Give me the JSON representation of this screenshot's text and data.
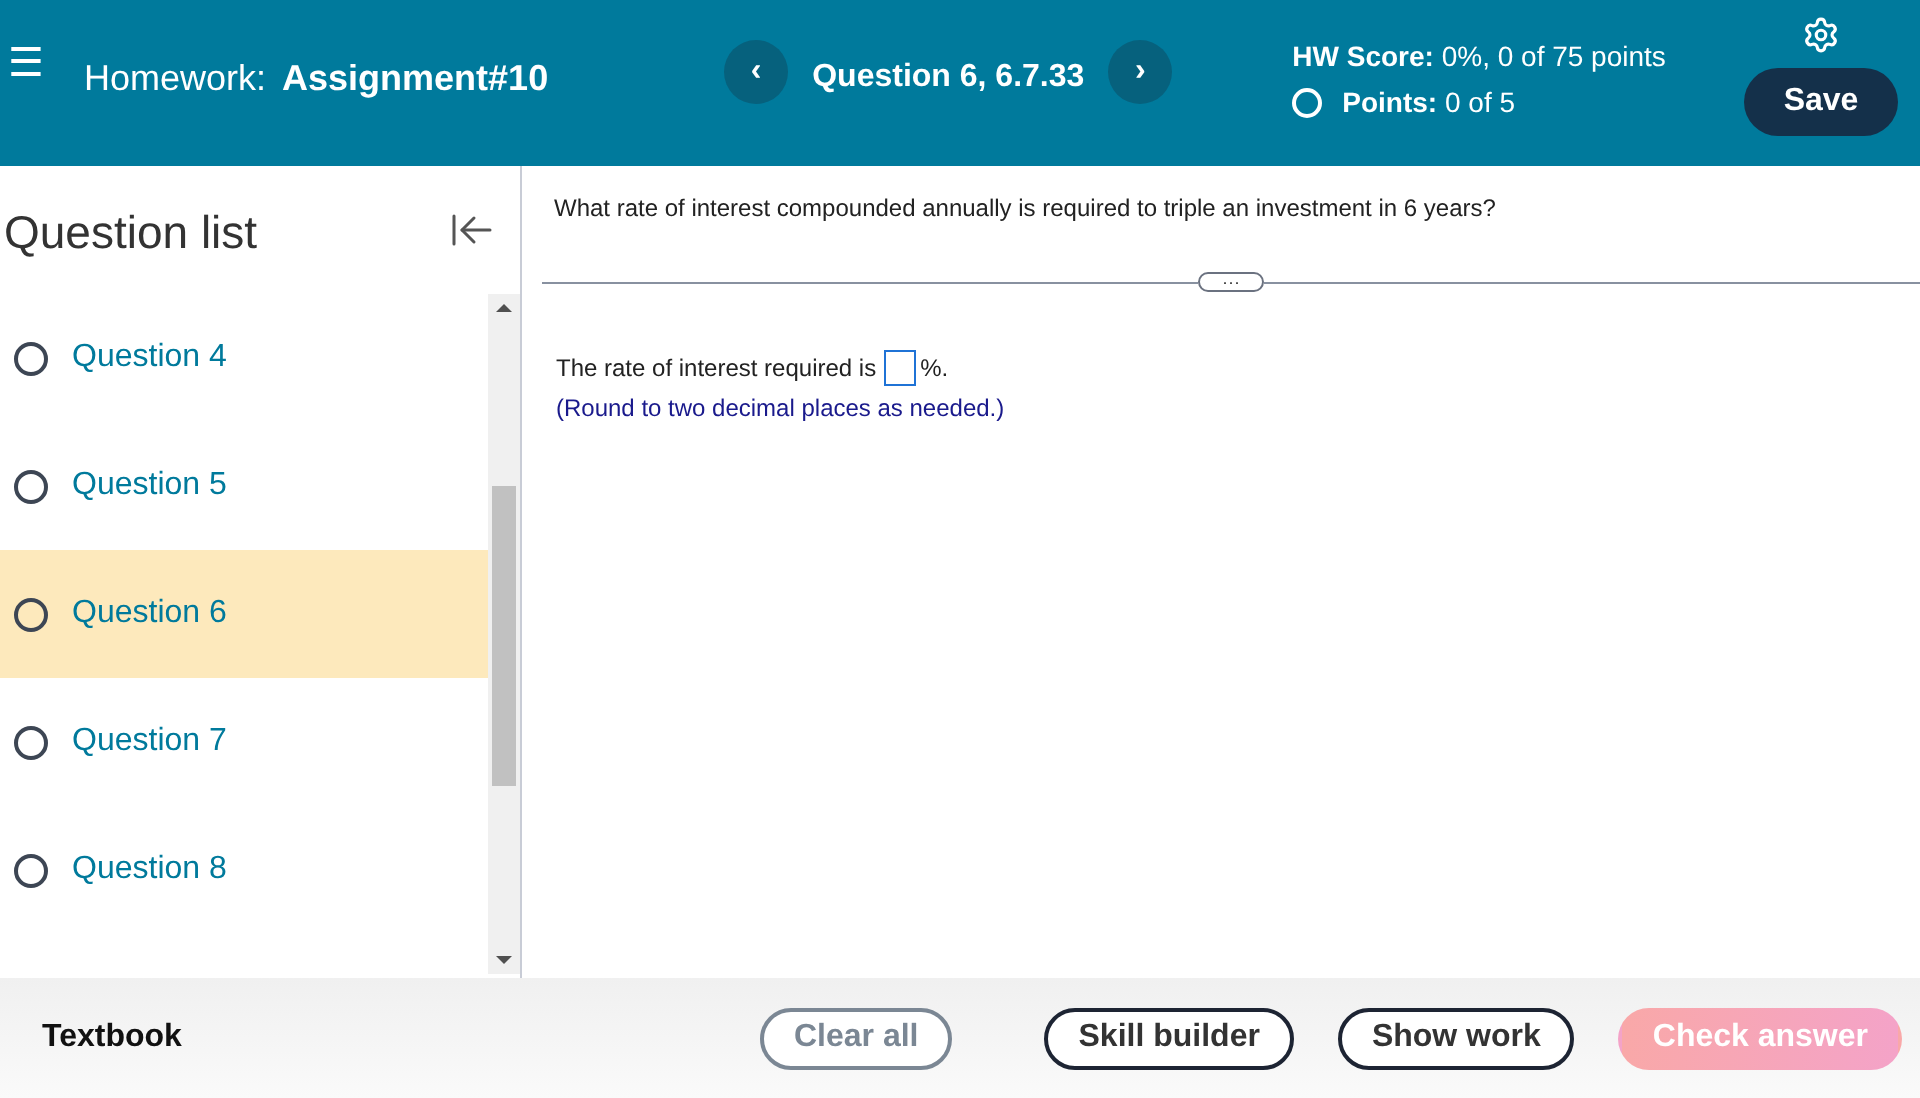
{
  "header": {
    "menu_icon": "☰",
    "homework_label": "Homework:",
    "assignment": "Assignment#10",
    "question_title": "Question 6, 6.7.33",
    "prev_icon": "‹",
    "next_icon": "›",
    "hw_score_label": "HW Score:",
    "hw_score_value": "0%, 0 of 75 points",
    "points_label": "Points:",
    "points_value": "0 of 5",
    "save": "Save"
  },
  "sidebar": {
    "title": "Question list",
    "items": [
      {
        "label": "Question 4",
        "selected": false
      },
      {
        "label": "Question 5",
        "selected": false
      },
      {
        "label": "Question 6",
        "selected": true
      },
      {
        "label": "Question 7",
        "selected": false
      },
      {
        "label": "Question 8",
        "selected": false
      }
    ]
  },
  "question": {
    "prompt": "What rate of interest compounded annually is required to triple an investment in 6 years?",
    "divider_button": "···",
    "answer_before": "The rate of interest required is",
    "answer_after": "%.",
    "hint": "(Round to two decimal places as needed.)"
  },
  "footer": {
    "textbook": "Textbook",
    "buttons": [
      {
        "label": "Clear all",
        "kind": "outline",
        "disabled": true
      },
      {
        "label": "Skill builder",
        "kind": "outline",
        "disabled": false
      },
      {
        "label": "Show work",
        "kind": "outline",
        "disabled": false
      },
      {
        "label": "Check answer",
        "kind": "primary",
        "disabled": true
      }
    ]
  }
}
